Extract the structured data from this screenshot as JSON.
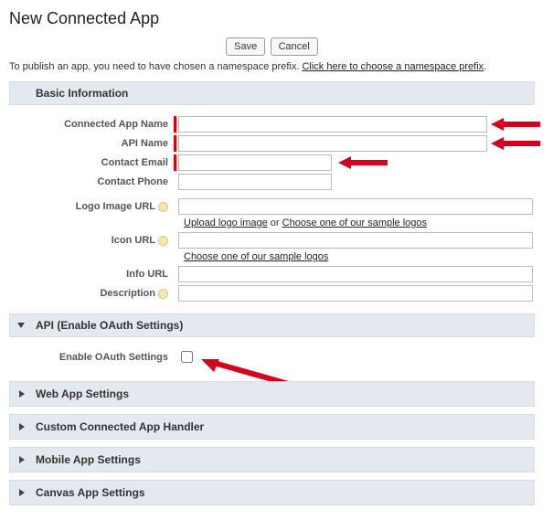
{
  "page": {
    "title": "New Connected App"
  },
  "buttons": {
    "save": "Save",
    "cancel": "Cancel"
  },
  "publish": {
    "text": "To publish an app, you need to have chosen a namespace prefix. ",
    "link": "Click here to choose a namespace prefix",
    "tail": "."
  },
  "sections": {
    "basic": "Basic Information",
    "api": "API (Enable OAuth Settings)",
    "web": "Web App Settings",
    "handler": "Custom Connected App Handler",
    "mobile": "Mobile App Settings",
    "canvas": "Canvas App Settings"
  },
  "fields": {
    "connected_app_name": {
      "label": "Connected App Name",
      "value": ""
    },
    "api_name": {
      "label": "API Name",
      "value": ""
    },
    "contact_email": {
      "label": "Contact Email",
      "value": ""
    },
    "contact_phone": {
      "label": "Contact Phone",
      "value": ""
    },
    "logo_image_url": {
      "label": "Logo Image URL",
      "value": ""
    },
    "icon_url": {
      "label": "Icon URL",
      "value": ""
    },
    "info_url": {
      "label": "Info URL",
      "value": ""
    },
    "description": {
      "label": "Description",
      "value": ""
    }
  },
  "links": {
    "upload_logo": "Upload logo image",
    "or": " or ",
    "choose_sample_logos": "Choose one of our sample logos",
    "choose_sample_logos2": "Choose one of our sample logos"
  },
  "oauth": {
    "enable_label": "Enable OAuth Settings",
    "enabled": false
  }
}
